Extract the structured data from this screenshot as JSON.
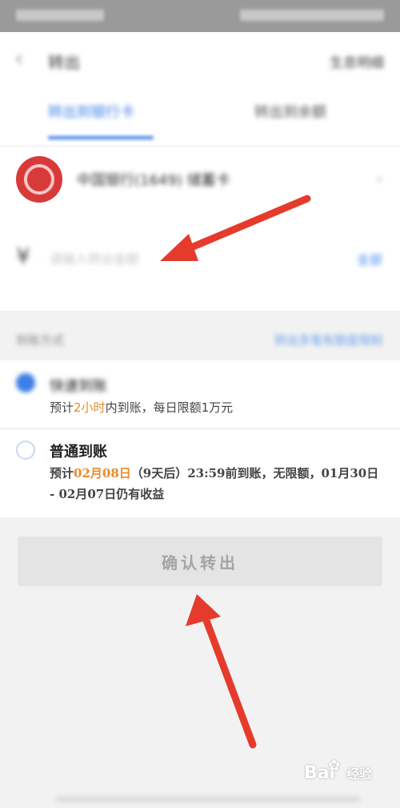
{
  "navbar": {
    "back_glyph": "‹",
    "title": "转出",
    "right_link": "生息明细"
  },
  "tabs": [
    {
      "label": "转出到银行卡"
    },
    {
      "label": "转出到余额"
    }
  ],
  "bank": {
    "name": "中国银行(1649) 储蓄卡",
    "chevron": "›"
  },
  "amount": {
    "icon": "yen-icon",
    "placeholder": "请输入转出金额",
    "all_link": "全部"
  },
  "method": {
    "label": "到账方式",
    "link": "转出多笔有额度限制"
  },
  "options": [
    {
      "title": "快速到账",
      "desc_prefix": "预计",
      "desc_highlight": "2小时",
      "desc_suffix": "内到账，每日限额1万元",
      "selected": true
    },
    {
      "title": "普通到账",
      "desc_prefix": "预计",
      "desc_highlight": "02月08日",
      "desc_suffix": "（9天后）23:59前到账，无限额，01月30日 - 02月07日仍有收益",
      "selected": false
    }
  ],
  "confirm_label": "确认转出",
  "watermark": {
    "text": "Bai",
    "suffix": "经验"
  },
  "colors": {
    "accent": "#3d7fe6",
    "highlight": "#e8892a",
    "annotation_arrow": "#e53b2c",
    "bank_red": "#d83a3a"
  }
}
